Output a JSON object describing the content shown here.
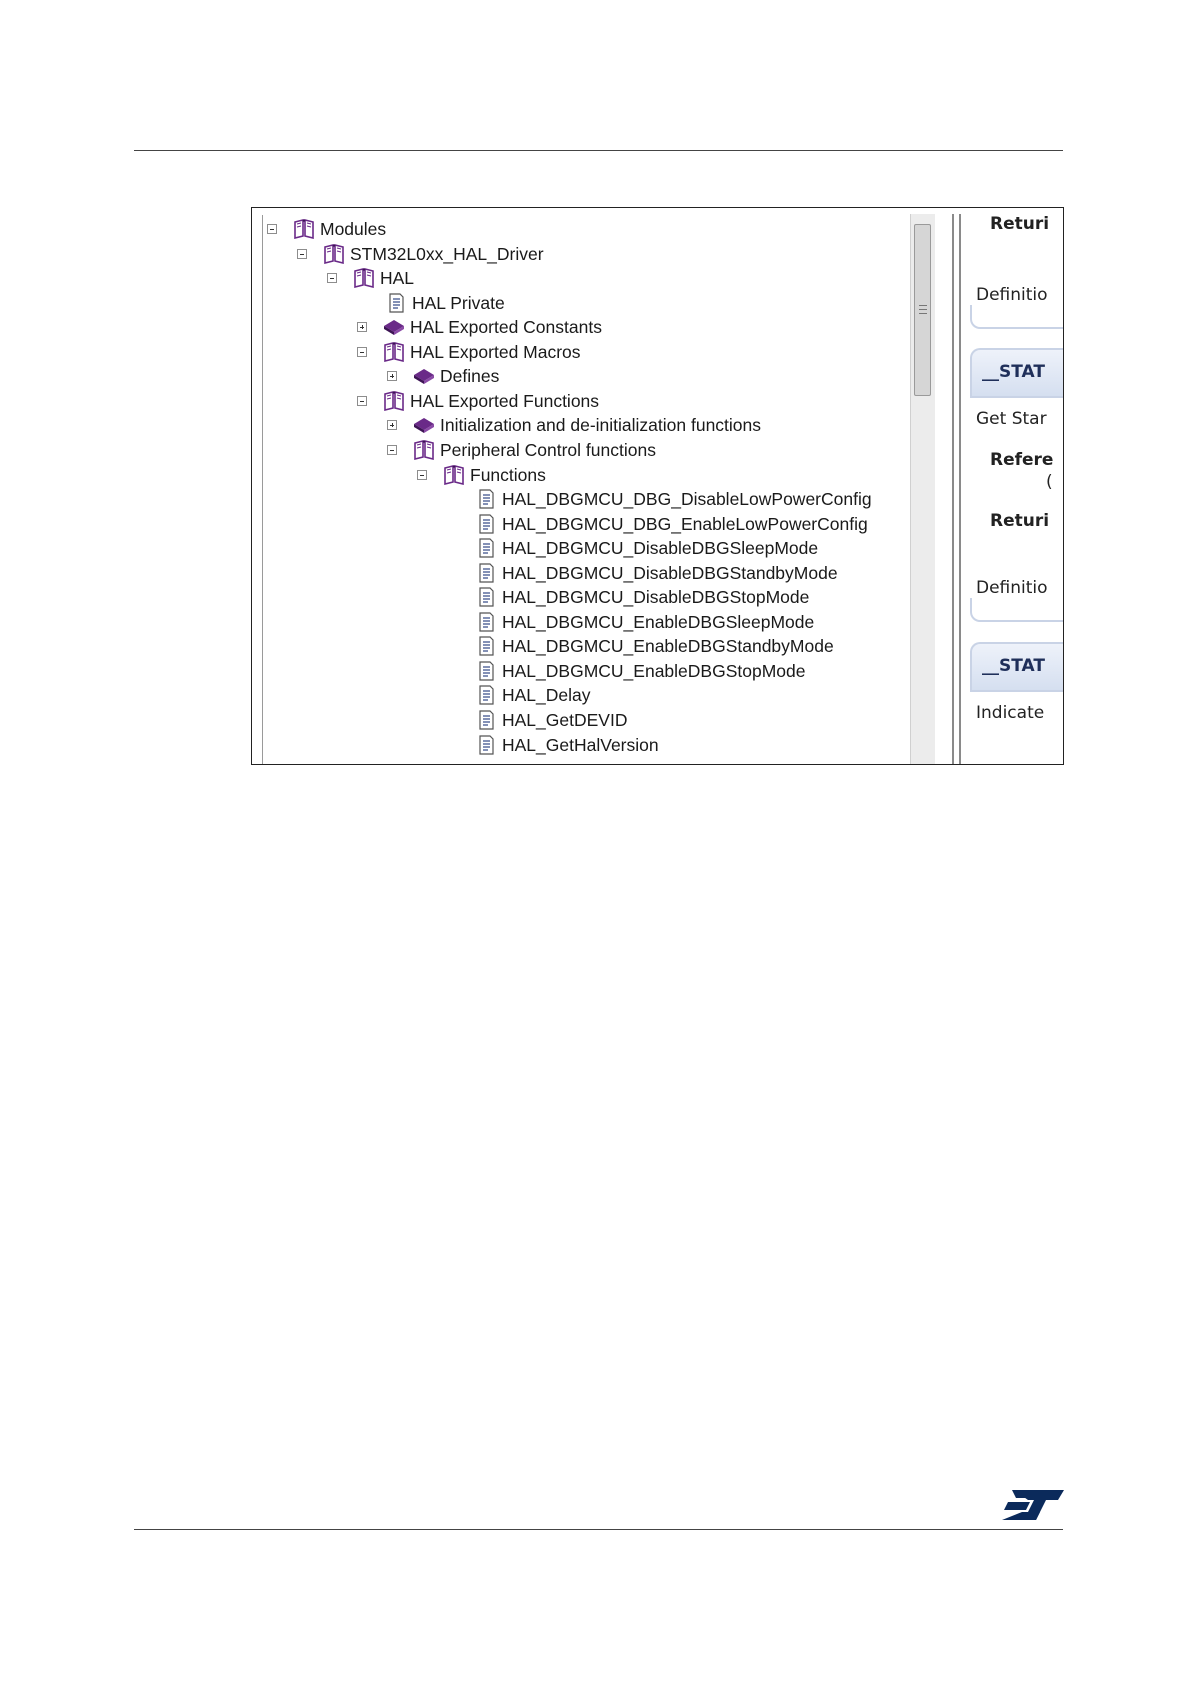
{
  "tree": {
    "rows": [
      {
        "label": "Modules",
        "level": 0,
        "toggle": "minus",
        "icon": "book-open-icon"
      },
      {
        "label": "STM32L0xx_HAL_Driver",
        "level": 1,
        "toggle": "minus",
        "icon": "book-open-icon"
      },
      {
        "label": "HAL",
        "level": 2,
        "toggle": "minus",
        "icon": "book-open-icon"
      },
      {
        "label": "HAL Private",
        "level": 3,
        "toggle": "none",
        "icon": "page-icon"
      },
      {
        "label": "HAL Exported Constants",
        "level": 3,
        "toggle": "plus",
        "icon": "book-closed-icon"
      },
      {
        "label": "HAL Exported Macros",
        "level": 3,
        "toggle": "minus",
        "icon": "book-open-icon"
      },
      {
        "label": "Defines",
        "level": 4,
        "toggle": "plus",
        "icon": "book-closed-icon"
      },
      {
        "label": "HAL Exported Functions",
        "level": 3,
        "toggle": "minus",
        "icon": "book-open-icon"
      },
      {
        "label": "Initialization and de-initialization functions",
        "level": 4,
        "toggle": "plus",
        "icon": "book-closed-icon"
      },
      {
        "label": "Peripheral Control functions",
        "level": 4,
        "toggle": "minus",
        "icon": "book-open-icon"
      },
      {
        "label": "Functions",
        "level": 5,
        "toggle": "minus",
        "icon": "book-open-icon"
      },
      {
        "label": "HAL_DBGMCU_DBG_DisableLowPowerConfig",
        "level": 6,
        "toggle": "none",
        "icon": "page-icon"
      },
      {
        "label": "HAL_DBGMCU_DBG_EnableLowPowerConfig",
        "level": 6,
        "toggle": "none",
        "icon": "page-icon"
      },
      {
        "label": "HAL_DBGMCU_DisableDBGSleepMode",
        "level": 6,
        "toggle": "none",
        "icon": "page-icon"
      },
      {
        "label": "HAL_DBGMCU_DisableDBGStandbyMode",
        "level": 6,
        "toggle": "none",
        "icon": "page-icon"
      },
      {
        "label": "HAL_DBGMCU_DisableDBGStopMode",
        "level": 6,
        "toggle": "none",
        "icon": "page-icon"
      },
      {
        "label": "HAL_DBGMCU_EnableDBGSleepMode",
        "level": 6,
        "toggle": "none",
        "icon": "page-icon"
      },
      {
        "label": "HAL_DBGMCU_EnableDBGStandbyMode",
        "level": 6,
        "toggle": "none",
        "icon": "page-icon"
      },
      {
        "label": "HAL_DBGMCU_EnableDBGStopMode",
        "level": 6,
        "toggle": "none",
        "icon": "page-icon"
      },
      {
        "label": "HAL_Delay",
        "level": 6,
        "toggle": "none",
        "icon": "page-icon"
      },
      {
        "label": "HAL_GetDEVID",
        "level": 6,
        "toggle": "none",
        "icon": "page-icon"
      },
      {
        "label": "HAL_GetHalVersion",
        "level": 6,
        "toggle": "none",
        "icon": "page-icon"
      }
    ]
  },
  "right_pane": {
    "return_1": "Returi",
    "definition_1": "Definitio",
    "header_1": "__STAT",
    "get_star": "Get Star",
    "reference": "Refere",
    "reference_sub": "(",
    "return_2": "Returi",
    "definition_2": "Definitio",
    "header_2": "__STAT",
    "indicate": "Indicate"
  },
  "colors": {
    "book": "#6a2a88",
    "book_spine": "#3d1455",
    "page": "#3a4f8a",
    "st_logo": "#0b2a5b"
  },
  "logo": "ST"
}
